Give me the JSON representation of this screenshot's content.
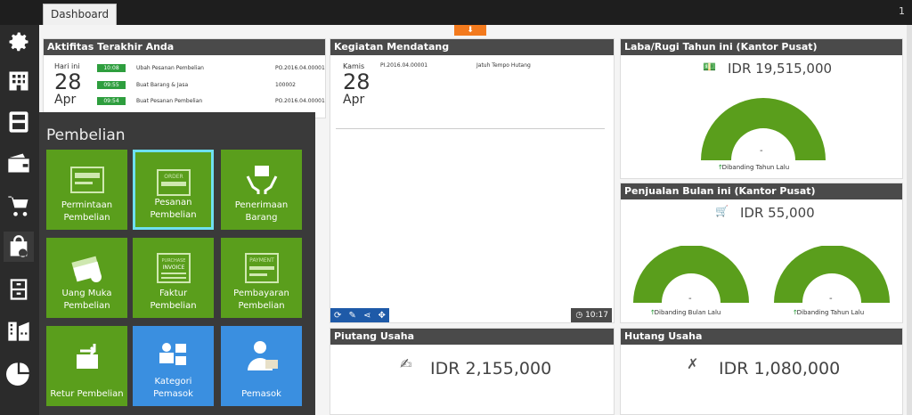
{
  "tab": {
    "label": "Dashboard"
  },
  "top_right": {
    "label": "1"
  },
  "sidebar": {
    "items": [
      {
        "icon": "gear-icon"
      },
      {
        "icon": "building-icon"
      },
      {
        "icon": "calculator-icon"
      },
      {
        "icon": "wallet-icon"
      },
      {
        "icon": "cart-icon"
      },
      {
        "icon": "shopping-bag-icon"
      },
      {
        "icon": "archive-icon"
      },
      {
        "icon": "company-icon"
      },
      {
        "icon": "pie-chart-icon"
      }
    ]
  },
  "collapse": {
    "label": "⬇"
  },
  "aktifitas": {
    "title": "Aktifitas Terakhir Anda",
    "day": "Hari ini",
    "date": "28",
    "month": "Apr",
    "rows": [
      {
        "time": "10:08",
        "desc": "Ubah Pesanan Pembelian",
        "doc": "PO.2016.04.00001"
      },
      {
        "time": "09:55",
        "desc": "Buat Barang & Jasa",
        "doc": "100002"
      },
      {
        "time": "09:54",
        "desc": "Buat Pesanan Pembelian",
        "doc": "PO.2016.04.00001"
      }
    ]
  },
  "kegiatan": {
    "title": "Kegiatan Mendatang",
    "day": "Kamis",
    "date": "28",
    "month": "Apr",
    "doc": "PI.2016.04.00001",
    "desc": "Jatuh Tempo Hutang",
    "clock": "10:17"
  },
  "laba": {
    "title": "Laba/Rugi Tahun ini (Kantor Pusat)",
    "amount": "IDR 19,515,000",
    "gauge_value": "-",
    "gauge_label": "Dibanding Tahun Lalu"
  },
  "penjualan": {
    "title": "Penjualan Bulan ini (Kantor Pusat)",
    "amount": "IDR 55,000",
    "gauge1_value": "-",
    "gauge1_label": "Dibanding Bulan Lalu",
    "gauge2_value": "-",
    "gauge2_label": "Dibanding Tahun Lalu"
  },
  "piutang": {
    "title": "Piutang Usaha",
    "amount": "IDR 2,155,000"
  },
  "hutang": {
    "title": "Hutang Usaha",
    "amount": "IDR 1,080,000"
  },
  "menu": {
    "title": "Pembelian",
    "tiles": [
      {
        "label1": "Permintaan",
        "label2": "Pembelian",
        "icon": "request-icon",
        "color": "#5a9e1c"
      },
      {
        "label1": "Pesanan",
        "label2": "Pembelian",
        "icon": "order-icon",
        "icon_text": "ORDER",
        "color": "#5a9e1c"
      },
      {
        "label1": "Penerimaan",
        "label2": "Barang",
        "icon": "receive-goods-icon",
        "color": "#5a9e1c"
      },
      {
        "label1": "Uang Muka",
        "label2": "Pembelian",
        "icon": "money-icon",
        "color": "#5a9e1c"
      },
      {
        "label1": "Faktur",
        "label2": "Pembelian",
        "icon": "invoice-icon",
        "icon_text1": "PURCHASE",
        "icon_text2": "INVOICE",
        "color": "#5a9e1c"
      },
      {
        "label1": "Pembayaran",
        "label2": "Pembelian",
        "icon": "payment-icon",
        "icon_text": "PAYMENT",
        "color": "#5a9e1c"
      },
      {
        "label1": "Retur Pembelian",
        "label2": "",
        "icon": "return-icon",
        "color": "#5a9e1c"
      },
      {
        "label1": "Kategori",
        "label2": "Pemasok",
        "icon": "supplier-category-icon",
        "color": "#3a8fe0"
      },
      {
        "label1": "Pemasok",
        "label2": "",
        "icon": "supplier-icon",
        "color": "#3a8fe0"
      }
    ]
  }
}
